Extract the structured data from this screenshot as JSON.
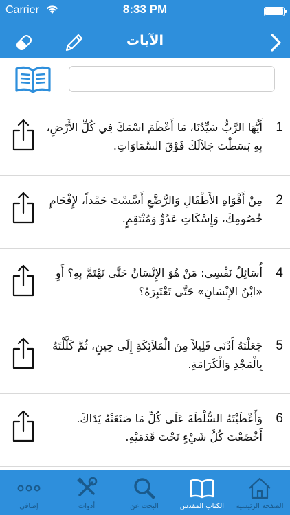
{
  "status_bar": {
    "carrier": "Carrier",
    "time": "8:33 PM"
  },
  "nav": {
    "title": "الآيات",
    "left_icons": [
      "eraser-icon",
      "pencil-icon"
    ],
    "right_icon": "chevron-right-icon"
  },
  "search": {
    "value": "",
    "placeholder": ""
  },
  "verses": [
    {
      "num": "1",
      "text": "أَيُّهَا الرَّبُّ سَيِّدُنَا، مَا أَعْظَمَ اسْمَكَ فِي كُلِّ الأَرْضِ، بِهِ بَسَطْتَ جَلاَلَكَ فَوْقَ السَّمَاوَاتِ."
    },
    {
      "num": "2",
      "text": "مِنْ أَفْوَاهِ الأَطْفَالِ وَالرُّضَّعِ أَسَّسْتَ حَمْداً، لإِفْحَامِ خُصُومِكَ، وَإِسْكَاتِ عَدُوٍّ وَمُنْتَقِمٍ."
    },
    {
      "num": "4",
      "text": "أُسَائِلُ نَفْسِي: مَنْ هُوَ الإِنْسَانُ حَتَّى تَهْتَمَّ بِهِ؟ أَوِ «ابْنُ الإِنْسَانِ» حَتَّى تَعْتَبِرَهُ؟"
    },
    {
      "num": "5",
      "text": "جَعَلْتَهُ أَدْنَى قَلِيلاً مِنَ الْمَلاَئِكَةِ إِلَى حِينٍ، ثُمَّ كَلَّلْتَهُ بِالْمَجْدِ وَالْكَرَامَةِ."
    },
    {
      "num": "6",
      "text": "وَأَعْطَيْتَهُ السُّلْطَةَ عَلَى كُلِّ مَا صَنَعَتْهُ يَدَاكَ. أَخْضَعْتَ كُلَّ شَيْءٍ تَحْتَ قَدَمَيْهِ."
    }
  ],
  "tabs": [
    {
      "label": "إضافي",
      "icon": "more-icon",
      "active": false
    },
    {
      "label": "أدوات",
      "icon": "tools-icon",
      "active": false
    },
    {
      "label": "البحث عن",
      "icon": "search-icon",
      "active": false
    },
    {
      "label": "الكتاب المقدس",
      "icon": "book-icon",
      "active": true
    },
    {
      "label": "الصفحة الرئيسية",
      "icon": "home-icon",
      "active": false
    }
  ],
  "colors": {
    "primary": "#2e8fdc",
    "icon_inactive": "#1a5a8c",
    "icon_active": "#ffffff"
  }
}
